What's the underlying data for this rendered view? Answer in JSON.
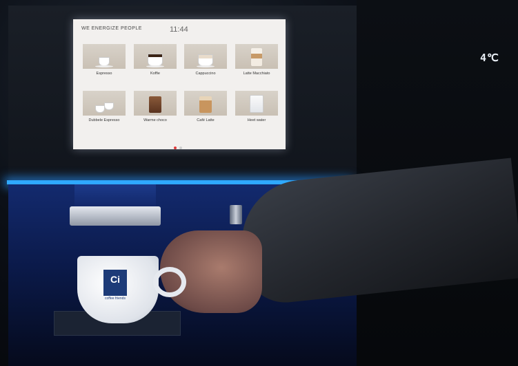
{
  "machine": {
    "temperature_display": "4℃",
    "screen": {
      "header": "WE ENERGIZE PEOPLE",
      "clock": "11:44",
      "drinks": [
        {
          "label": "Espresso",
          "icon": "espresso-cup-icon"
        },
        {
          "label": "Koffie",
          "icon": "coffee-cup-icon"
        },
        {
          "label": "Cappuccino",
          "icon": "cappuccino-cup-icon"
        },
        {
          "label": "Latte Macchiato",
          "icon": "latte-glass-icon"
        },
        {
          "label": "Dubbele Espresso",
          "icon": "double-espresso-icon"
        },
        {
          "label": "Warme choco",
          "icon": "hot-chocolate-icon"
        },
        {
          "label": "Café Latte",
          "icon": "cafe-latte-icon"
        },
        {
          "label": "Heet water",
          "icon": "hot-water-glass-icon"
        }
      ],
      "pager": {
        "current_page": 1,
        "total_pages": 2,
        "active_color": "#e03a3a",
        "inactive_color": "#cfcfcf"
      }
    },
    "cup_logo": {
      "mark": "Ci",
      "text": "coffee friends"
    },
    "led_color": "#2fa9ff"
  }
}
